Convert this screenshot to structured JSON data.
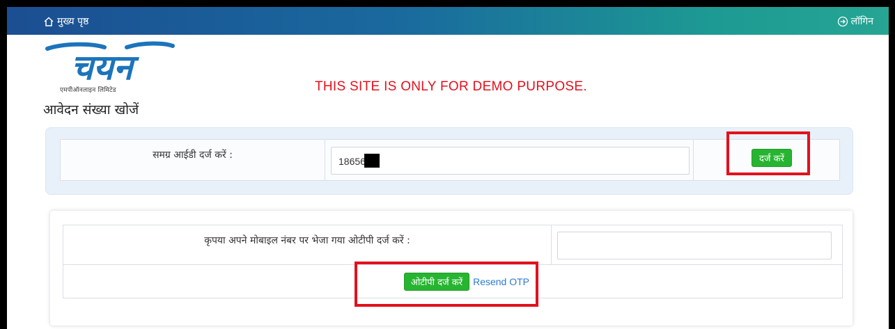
{
  "topbar": {
    "home_label": "मुख्य पृष्ठ",
    "home_icon": "home-icon",
    "login_label": "लॉगिन",
    "login_icon": "login-arrow-icon"
  },
  "logo": {
    "wordmark": "चयन",
    "caption": "एमपीऑनलाइन लिमिटेड"
  },
  "demo_notice": "THIS SITE IS ONLY FOR DEMO PURPOSE.",
  "page_title": "आवेदन संख्या खोजें",
  "search": {
    "label": "समग्र आईडी दर्ज करें :",
    "value": "18656"
  },
  "submit_button": "दर्ज करें",
  "otp": {
    "label": "कृपया अपने मोबाइल नंबर पर भेजा गया ओटीपी दर्ज करें :",
    "value": "",
    "submit_button": "ओटीपी दर्ज करें",
    "resend_link": "Resend OTP"
  },
  "colors": {
    "accent_red": "#e3101d",
    "button_green": "#27b531",
    "link_blue": "#2a7bd0"
  }
}
